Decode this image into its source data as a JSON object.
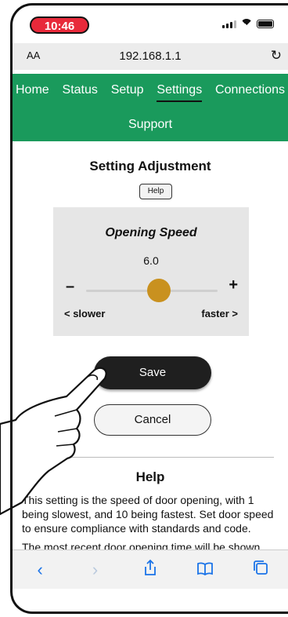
{
  "status_bar": {
    "time": "10:46"
  },
  "browser": {
    "aa_label": "AA",
    "url": "192.168.1.1"
  },
  "nav": {
    "items": [
      "Home",
      "Status",
      "Setup",
      "Settings",
      "Connections"
    ],
    "active": "Settings",
    "support": "Support"
  },
  "page": {
    "title": "Setting Adjustment",
    "help_button": "Help"
  },
  "setting": {
    "title": "Opening Speed",
    "value_text": "6.0",
    "value": 6.0,
    "min": 1,
    "max": 10,
    "minus_label": "–",
    "plus_label": "+",
    "slower_label": "< slower",
    "faster_label": "faster >"
  },
  "actions": {
    "save": "Save",
    "cancel": "Cancel"
  },
  "help": {
    "title": "Help",
    "paragraph1": "This setting is the speed of door opening, with 1 being slowest, and 10 being fastest. Set door speed to ensure compliance with standards and code.",
    "paragraph2": "The most recent door opening time will be shown here after the door opens and closes."
  },
  "toolbar": [
    "back-icon",
    "forward-icon",
    "share-icon",
    "bookmarks-icon",
    "tabs-icon"
  ],
  "colors": {
    "nav_green": "#1a9a5c",
    "thumb": "#c9911f",
    "time_pill": "#e8293a",
    "link_blue": "#1a73e8"
  }
}
